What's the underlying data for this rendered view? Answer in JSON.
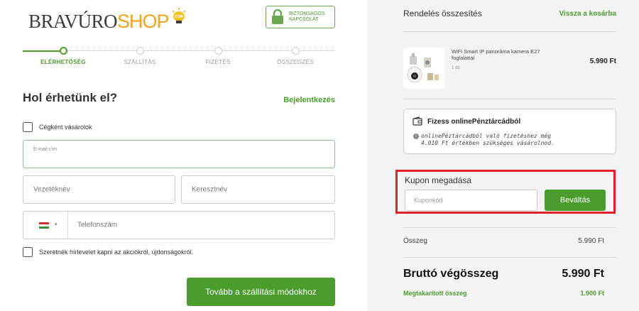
{
  "brand": {
    "logo_main": "BRAVÚRO",
    "logo_shop": "SHOP",
    "logo_badge": "COM"
  },
  "secure_badge": {
    "line1": "BIZTONSÁGOS",
    "line2": "KAPCSOLAT"
  },
  "steps": [
    {
      "label": "ELÉRHETŐSÉG",
      "active": true
    },
    {
      "label": "SZÁLLÍTÁS",
      "active": false
    },
    {
      "label": "FIZETÉS",
      "active": false
    },
    {
      "label": "ÖSSZEGZÉS",
      "active": false
    }
  ],
  "form": {
    "title": "Hol érhetünk el?",
    "login_link": "Bejelentkezés",
    "company_checkbox": "Cégként vásárolok",
    "email_label": "E-mail cím",
    "email_value": "",
    "lastname_placeholder": "Vezetéknév",
    "firstname_placeholder": "Keresztnév",
    "phone_placeholder": "Telefonszám",
    "phone_country_flag": "flag-hu-icon",
    "newsletter_checkbox": "Szeretnék hírlevelet kapni az akciókról, újdonságokról.",
    "next_button": "Tovább a szállítási módokhoz"
  },
  "summary": {
    "title": "Rendelés összesítés",
    "back_link": "Vissza a kosárba",
    "product": {
      "name": "WiFi Smart IP panoráma kamera E27 foglalattal",
      "qty": "1 db",
      "price": "5.990 Ft",
      "image_icon": "camera-bulb-icon"
    },
    "wallet": {
      "title": "Fizess onlinePénztárcádból",
      "description": "onlinePéztárcádból való fizetéshez még 4.010 Ft értékben szükséges vásárolnod."
    },
    "coupon": {
      "title": "Kupon megadása",
      "placeholder": "Kuponkód",
      "button": "Beváltás"
    },
    "subtotal_label": "Összeg",
    "subtotal_value": "5.990 Ft",
    "gross_label": "Bruttó végösszeg",
    "gross_value": "5.990 Ft",
    "saved_label": "Megtakarított összeg",
    "saved_value": "1.900 Ft"
  },
  "colors": {
    "accent": "#4a9c2d",
    "highlight": "#e0202a",
    "panel_bg": "#f3f3f3",
    "logo_orange": "#f3a21b"
  }
}
